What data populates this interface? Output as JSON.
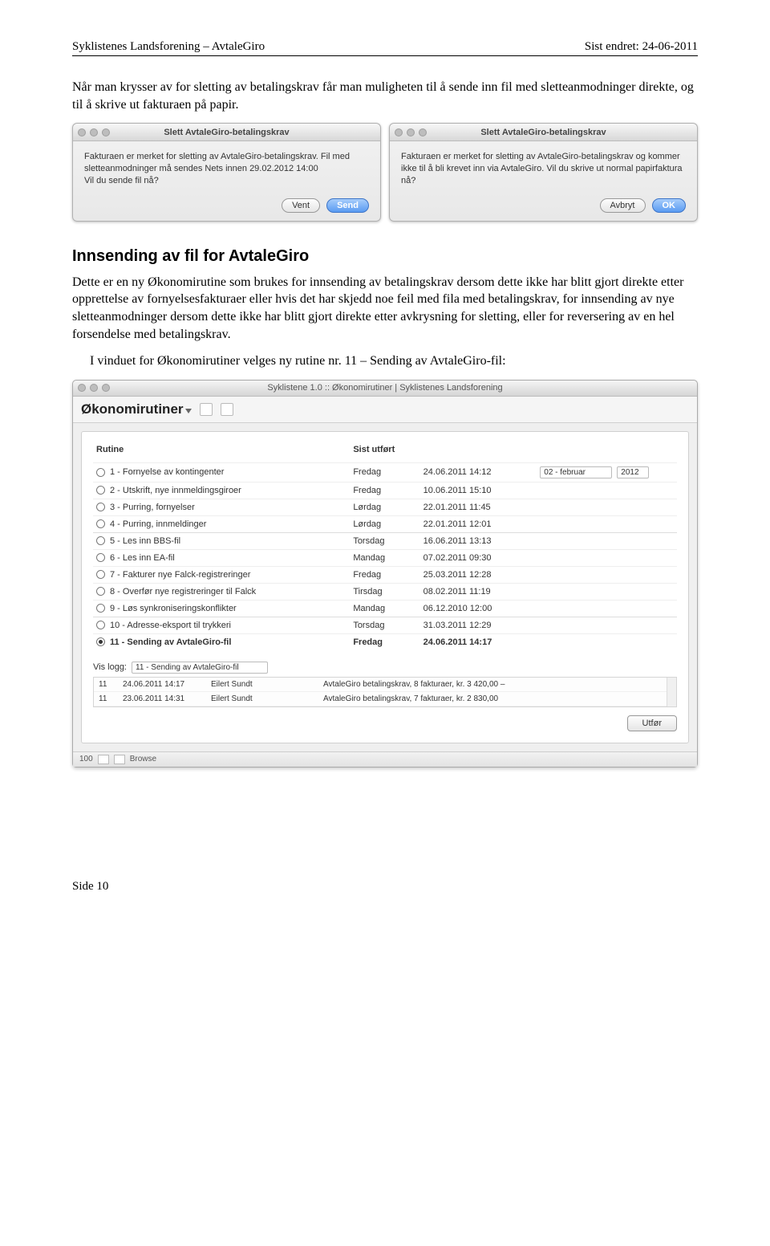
{
  "header": {
    "left": "Syklistenes Landsforening – AvtaleGiro",
    "right": "Sist endret: 24-06-2011"
  },
  "intro": "Når man krysser av for sletting av betalingskrav får man muligheten til å sende inn fil med sletteanmodninger direkte, og til å skrive ut fakturaen på papir.",
  "dialog1": {
    "title": "Slett AvtaleGiro-betalingskrav",
    "body": "Fakturaen er merket for sletting av AvtaleGiro-betalingskrav. Fil med sletteanmodninger må sendes Nets innen 29.02.2012 14:00\nVil du sende fil nå?",
    "btn_secondary": "Vent",
    "btn_primary": "Send"
  },
  "dialog2": {
    "title": "Slett AvtaleGiro-betalingskrav",
    "body": "Fakturaen er merket for sletting av AvtaleGiro-betalingskrav og kommer ikke til å bli krevet inn via AvtaleGiro. Vil du skrive ut normal papirfaktura nå?",
    "btn_secondary": "Avbryt",
    "btn_primary": "OK"
  },
  "h2": "Innsending av fil for AvtaleGiro",
  "para2": "Dette er en ny Økonomirutine som brukes for innsending av betalingskrav dersom dette ikke har blitt gjort direkte etter opprettelse av fornyelsesfakturaer eller hvis det har skjedd noe feil med fila med betalingskrav, for innsending av nye sletteanmodninger dersom dette ikke har blitt gjort direkte etter avkrysning for sletting, eller for reversering av en hel forsendelse med betalingskrav.",
  "para3": "I vinduet for Økonomirutiner velges ny rutine nr. 11 – Sending av AvtaleGiro-fil:",
  "app": {
    "title": "Syklistene 1.0 :: Økonomirutiner | Syklistenes Landsforening",
    "toolbar_title": "Økonomirutiner",
    "col_rutine": "Rutine",
    "col_sist": "Sist utført",
    "month_select": "02 - februar",
    "year_select": "2012",
    "rows": [
      {
        "sel": false,
        "label": "1 - Fornyelse av kontingenter",
        "day": "Fredag",
        "date": "24.06.2011 14:12",
        "bold": false
      },
      {
        "sel": false,
        "label": "2 - Utskrift, nye innmeldingsgiroer",
        "day": "Fredag",
        "date": "10.06.2011 15:10",
        "bold": false
      },
      {
        "sel": false,
        "label": "3 - Purring, fornyelser",
        "day": "Lørdag",
        "date": "22.01.2011 11:45",
        "bold": false
      },
      {
        "sel": false,
        "label": "4 - Purring, innmeldinger",
        "day": "Lørdag",
        "date": "22.01.2011 12:01",
        "bold": false
      },
      {
        "sel": false,
        "label": "5 - Les inn BBS-fil",
        "day": "Torsdag",
        "date": "16.06.2011 13:13",
        "bold": false,
        "sep": true
      },
      {
        "sel": false,
        "label": "6 - Les inn EA-fil",
        "day": "Mandag",
        "date": "07.02.2011 09:30",
        "bold": false
      },
      {
        "sel": false,
        "label": "7 - Fakturer nye Falck-registreringer",
        "day": "Fredag",
        "date": "25.03.2011 12:28",
        "bold": false
      },
      {
        "sel": false,
        "label": "8 - Overfør nye registreringer til Falck",
        "day": "Tirsdag",
        "date": "08.02.2011 11:19",
        "bold": false
      },
      {
        "sel": false,
        "label": "9 - Løs synkroniseringskonflikter",
        "day": "Mandag",
        "date": "06.12.2010 12:00",
        "bold": false
      },
      {
        "sel": false,
        "label": "10 - Adresse-eksport til trykkeri",
        "day": "Torsdag",
        "date": "31.03.2011 12:29",
        "bold": false,
        "sep": true
      },
      {
        "sel": true,
        "label": "11 - Sending av AvtaleGiro-fil",
        "day": "Fredag",
        "date": "24.06.2011 14:17",
        "bold": true
      }
    ],
    "vis_logg_label": "Vis logg:",
    "vis_logg_value": "11 - Sending av AvtaleGiro-fil",
    "log": [
      {
        "n": "11",
        "dt": "24.06.2011 14:17",
        "who": "Eilert Sundt",
        "msg": "AvtaleGiro betalingskrav, 8 fakturaer, kr. 3 420,00 –"
      },
      {
        "n": "11",
        "dt": "23.06.2011 14:31",
        "who": "Eilert Sundt",
        "msg": "AvtaleGiro betalingskrav, 7 fakturaer, kr. 2 830,00"
      }
    ],
    "utfor_btn": "Utfør",
    "status_count": "100",
    "status_mode": "Browse"
  },
  "footer": "Side 10"
}
